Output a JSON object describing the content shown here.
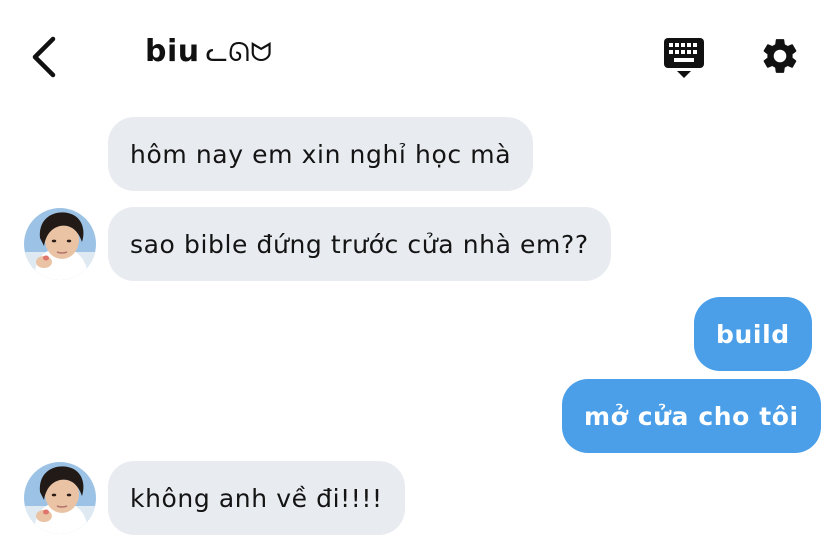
{
  "header": {
    "back_icon": "chevron-left-icon",
    "title": "biu",
    "title_emoji": "ᓚᘏᗢ",
    "keyboard_icon": "keyboard-icon",
    "settings_icon": "gear-icon"
  },
  "messages": [
    {
      "direction": "incoming",
      "text": "hôm nay em xin nghỉ học mà",
      "avatar": false
    },
    {
      "direction": "incoming",
      "text": "sao bible đứng trước cửa nhà em??",
      "avatar": true
    },
    {
      "direction": "outgoing",
      "text": "build"
    },
    {
      "direction": "outgoing",
      "text": "mở cửa cho tôi"
    },
    {
      "direction": "incoming",
      "text": "không anh về đi!!!!",
      "avatar": true
    }
  ],
  "colors": {
    "incoming_bubble": "#e8ebf0",
    "outgoing_bubble": "#4a9fe8",
    "text_dark": "#141414",
    "icon": "#111111"
  }
}
